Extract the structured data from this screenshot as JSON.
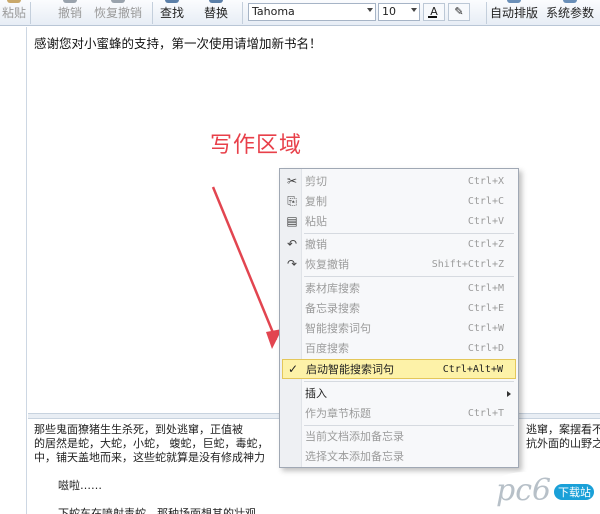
{
  "toolbar": {
    "paste": "粘贴",
    "undo": "撤销",
    "redo": "恢复撤销",
    "find": "查找",
    "replace": "替换",
    "font": "Tahoma",
    "size": "10",
    "auto_layout": "自动排版",
    "settings": "系统参数"
  },
  "editor": {
    "welcome": "感谢您对小蜜蜂的支持，第一次使用请增加新书名！",
    "annotation": "写作区域"
  },
  "bottom_text": {
    "line1": "那些鬼面獠猪生生杀死，到处逃窜，正值被",
    "line1_right": "逃窜，案摆看不",
    "line2": "的居然是蛇，大蛇，小蛇，   蝮蛇，巨蛇，毒蛇，",
    "line2_right": "抗外面的山野之",
    "line3": "中，铺天盖地而来，这些蛇就算是没有修成神力",
    "line4": "嗞啦……",
    "line5": "下蛇车在喷射毒蛇，那种场面想其的壮观"
  },
  "context_menu": {
    "items": [
      {
        "label": "剪切",
        "shortcut": "Ctrl+X",
        "icon": "scissors-icon"
      },
      {
        "label": "复制",
        "shortcut": "Ctrl+C",
        "icon": "copy-icon"
      },
      {
        "label": "粘贴",
        "shortcut": "Ctrl+V",
        "icon": "clipboard-icon"
      },
      {
        "label": "撤销",
        "shortcut": "Ctrl+Z",
        "icon": "undo-icon"
      },
      {
        "label": "恢复撤销",
        "shortcut": "Shift+Ctrl+Z",
        "icon": "redo-icon"
      },
      {
        "label": "素材库搜索",
        "shortcut": "Ctrl+M"
      },
      {
        "label": "备忘录搜索",
        "shortcut": "Ctrl+E"
      },
      {
        "label": "智能搜索词句",
        "shortcut": "Ctrl+W"
      },
      {
        "label": "百度搜索",
        "shortcut": "Ctrl+D"
      },
      {
        "label": "启动智能搜索词句",
        "shortcut": "Ctrl+Alt+W",
        "icon": "check-icon"
      },
      {
        "label": "插入"
      },
      {
        "label": "作为章节标题",
        "shortcut": "Ctrl+T"
      },
      {
        "label": "当前文档添加备忘录"
      },
      {
        "label": "选择文本添加备忘录"
      }
    ]
  },
  "watermark": {
    "brand": "pc6",
    "sub": "下载站"
  },
  "colors": {
    "annotation": "#e8404a",
    "highlight": "#fdf2a8",
    "watermark": "#1aa0d8"
  }
}
